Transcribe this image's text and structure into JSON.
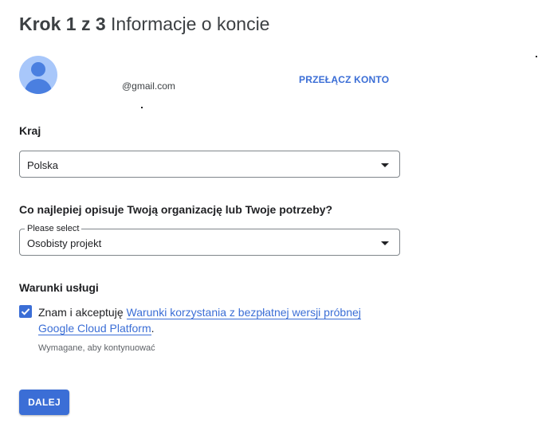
{
  "header": {
    "step": "Krok 1 z 3",
    "title": "Informacje o koncie"
  },
  "account": {
    "email": "@gmail.com",
    "switch_label": "PRZEŁĄCZ KONTO"
  },
  "country": {
    "label": "Kraj",
    "value": "Polska"
  },
  "organization": {
    "label": "Co najlepiej opisuje Twoją organizację lub Twoje potrzeby?",
    "legend": "Please select",
    "value": "Osobisty projekt"
  },
  "terms": {
    "heading": "Warunki usługi",
    "checked": true,
    "prefix": "Znam i akceptuję",
    "link1": "Warunki korzystania z bezpłatnej wersji próbnej",
    "link2": "Google Cloud Platform",
    "suffix": ".",
    "hint": "Wymagane, aby kontynuować"
  },
  "actions": {
    "next_label": "DALEJ"
  },
  "colors": {
    "accent": "#3b6ed6",
    "avatar_bg": "#a8c7fa"
  }
}
